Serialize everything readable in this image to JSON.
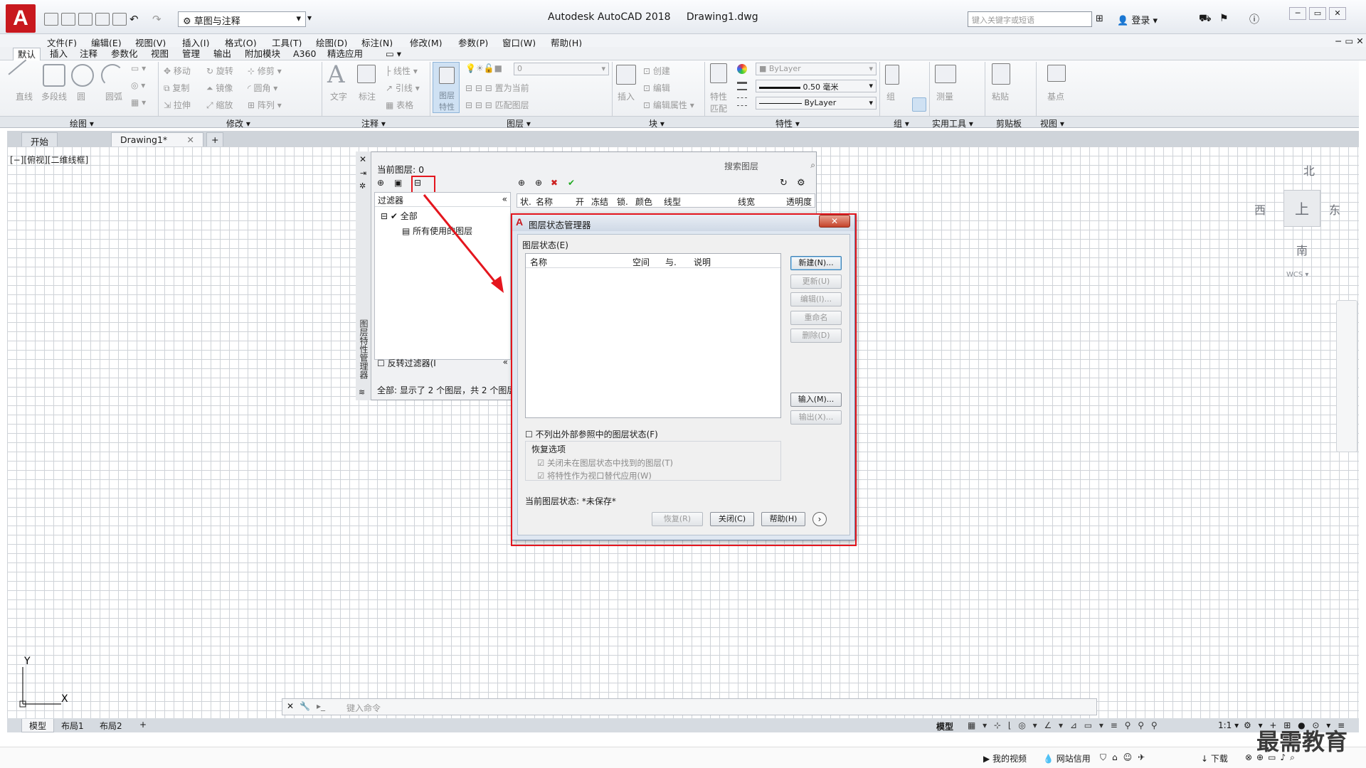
{
  "app": {
    "logo": "A",
    "workspace": "草图与注释",
    "title": "Autodesk AutoCAD 2018",
    "filename": "Drawing1.dwg",
    "search_placeholder": "键入关键字或短语",
    "login": "登录"
  },
  "menu": [
    "文件(F)",
    "编辑(E)",
    "视图(V)",
    "插入(I)",
    "格式(O)",
    "工具(T)",
    "绘图(D)",
    "标注(N)",
    "修改(M)",
    "参数(P)",
    "窗口(W)",
    "帮助(H)"
  ],
  "ribbon_tabs": [
    "默认",
    "插入",
    "注释",
    "参数化",
    "视图",
    "管理",
    "输出",
    "附加模块",
    "A360",
    "精选应用"
  ],
  "ribbon": {
    "draw": [
      "直线",
      "多段线",
      "圆",
      "圆弧"
    ],
    "modify": [
      "移动",
      "旋转",
      "修剪",
      "复制",
      "镜像",
      "圆角",
      "拉伸",
      "缩放",
      "阵列"
    ],
    "annotation": [
      "文字",
      "标注",
      "线性",
      "引线",
      "表格"
    ],
    "layers": [
      "图层特性",
      "置为当前",
      "匹配图层"
    ],
    "layer_current": "0",
    "block": [
      "插入",
      "创建",
      "编辑",
      "编辑属性"
    ],
    "properties": [
      "特性匹配",
      "ByLayer",
      "0.50 毫米",
      "ByLayer"
    ],
    "groups": [
      "组"
    ],
    "utilities": [
      "测量"
    ],
    "clipboard": [
      "粘贴"
    ],
    "base": [
      "基点"
    ],
    "panel_titles": [
      "绘图",
      "修改",
      "注释",
      "图层",
      "块",
      "特性",
      "组",
      "实用工具",
      "剪贴板",
      "视图"
    ]
  },
  "doc_tabs": [
    "开始",
    "Drawing1*"
  ],
  "viewport_label": "[−][俯视][二维线框]",
  "viewcube": {
    "north": "北",
    "south": "南",
    "east": "东",
    "west": "西",
    "center": "上",
    "wcs": "WCS"
  },
  "layer_manager": {
    "current_layer": "当前图层: 0",
    "search": "搜索图层",
    "filters_header": "过滤器",
    "tree_all": "全部",
    "tree_used": "所有使用的图层",
    "invert_filter": "反转过滤器(I",
    "status": "全部: 显示了 2 个图层，共 2 个图层",
    "columns": [
      "状.",
      "名称",
      "开",
      "冻结",
      "锁.",
      "颜色",
      "线型",
      "线宽",
      "透明度"
    ],
    "sidebar_title": "图层特性管理器"
  },
  "dialog": {
    "title": "图层状态管理器",
    "group_label": "图层状态(E)",
    "columns": [
      "名称",
      "空间",
      "与.",
      "说明"
    ],
    "buttons": [
      "新建(N)...",
      "更新(U)",
      "编辑(I)...",
      "重命名",
      "删除(D)",
      "输入(M)...",
      "输出(X)..."
    ],
    "checkbox_xref": "不列出外部参照中的图层状态(F)",
    "restore_group": "恢复选项",
    "restore_opt1": "关闭未在图层状态中找到的图层(T)",
    "restore_opt2": "将特性作为视口替代应用(W)",
    "current_state": "当前图层状态: *未保存*",
    "bottom_buttons": [
      "恢复(R)",
      "关闭(C)",
      "帮助(H)"
    ]
  },
  "command_placeholder": "键入命令",
  "layout_tabs": [
    "模型",
    "布局1",
    "布局2"
  ],
  "status": {
    "model": "模型",
    "scale": "1:1"
  },
  "sysbar": [
    "我的视频",
    "网站信用",
    "下载"
  ],
  "watermark": "最需教育",
  "colors": {
    "accent_red": "#e4161e",
    "autocad_red": "#c8181e"
  }
}
